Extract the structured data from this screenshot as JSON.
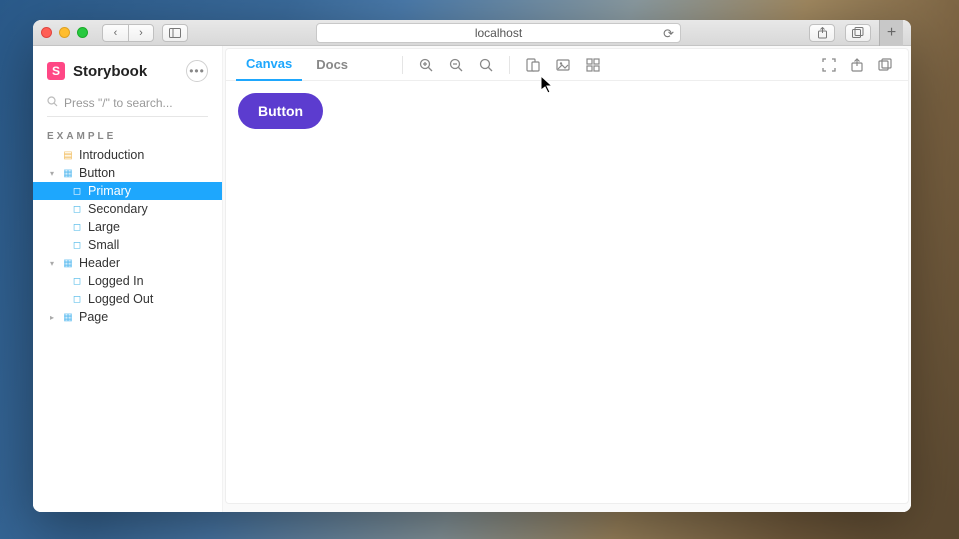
{
  "browser": {
    "address": "localhost"
  },
  "app": {
    "name": "Storybook",
    "logo_letter": "S",
    "menu_glyph": "•••"
  },
  "search": {
    "placeholder": "Press \"/\" to search..."
  },
  "sidebar": {
    "group_label": "EXAMPLE",
    "items": [
      {
        "label": "Introduction",
        "type": "doc"
      },
      {
        "label": "Button",
        "type": "component",
        "expanded": true
      },
      {
        "label": "Primary",
        "type": "story",
        "selected": true
      },
      {
        "label": "Secondary",
        "type": "story"
      },
      {
        "label": "Large",
        "type": "story"
      },
      {
        "label": "Small",
        "type": "story"
      },
      {
        "label": "Header",
        "type": "component",
        "expanded": true
      },
      {
        "label": "Logged In",
        "type": "story"
      },
      {
        "label": "Logged Out",
        "type": "story"
      },
      {
        "label": "Page",
        "type": "component",
        "expanded": false
      }
    ]
  },
  "tabs": {
    "canvas": "Canvas",
    "docs": "Docs",
    "active": "Canvas"
  },
  "preview": {
    "button_label": "Button"
  }
}
